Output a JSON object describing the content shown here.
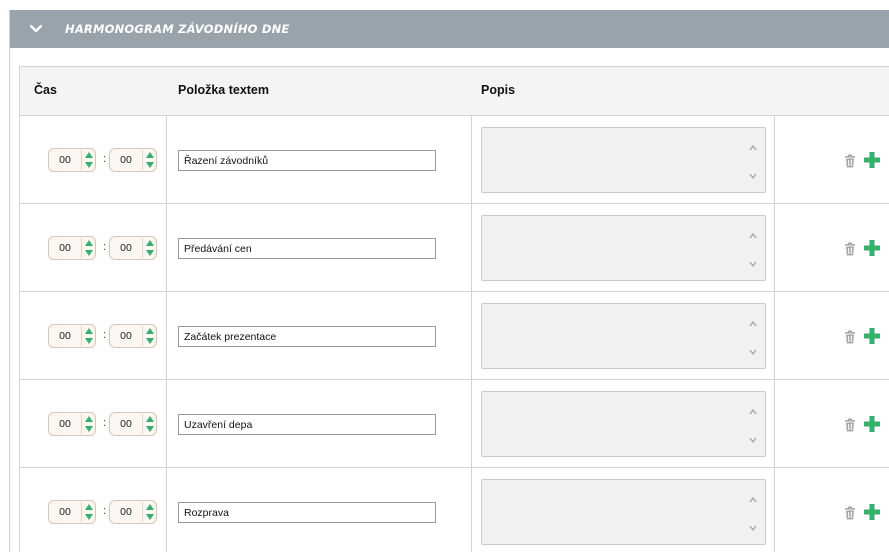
{
  "panel": {
    "title": "HARMONOGRAM ZÁVODNÍHO DNE",
    "expanded_icon": "chevron-down-icon",
    "header_color": "#98a3ab"
  },
  "table": {
    "headers": {
      "time": "Čas",
      "item": "Položka textem",
      "desc": "Popis"
    },
    "colon": ":",
    "rows": [
      {
        "hour": "00",
        "minute": "00",
        "item": "Řazení závodníků",
        "description": ""
      },
      {
        "hour": "00",
        "minute": "00",
        "item": "Předávání cen",
        "description": ""
      },
      {
        "hour": "00",
        "minute": "00",
        "item": "Začátek prezentace",
        "description": ""
      },
      {
        "hour": "00",
        "minute": "00",
        "item": "Uzavření depa",
        "description": ""
      },
      {
        "hour": "00",
        "minute": "00",
        "item": "Rozprava",
        "description": ""
      }
    ]
  },
  "colors": {
    "accent_green": "#2fb36b",
    "trash_gray": "#a9a9a9"
  },
  "icons": {
    "delete": "trash-icon",
    "add": "plus-icon",
    "spin_up": "arrow-up-icon",
    "spin_down": "arrow-down-icon"
  }
}
